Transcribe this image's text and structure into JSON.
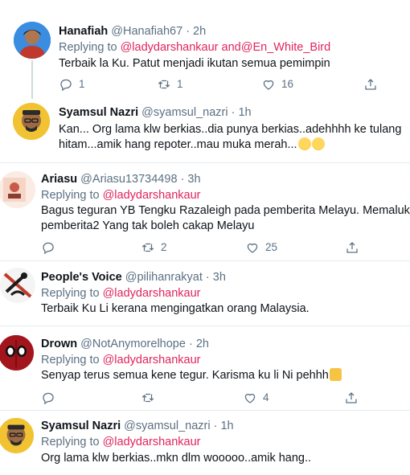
{
  "replying_label": "Replying to",
  "and_word": "and",
  "tweets": [
    {
      "name": "Hanafiah",
      "handle": "@Hanafiah67",
      "time": "· 2h",
      "mentions": [
        "@ladydarshankaur",
        "@En_White_Bird"
      ],
      "lines": [
        "Terbaik la Ku.  Patut menjadi ikutan semua pemimpin"
      ],
      "reply_count": "1",
      "retweet_count": "1",
      "like_count": "16"
    },
    {
      "name": "Syamsul Nazri",
      "handle": "@syamsul_nazri",
      "time": "· 1h",
      "lines": [
        "Kan... Org lama klw berkias..dia punya berkias..adehhhh ke tulang",
        "hitam...amik hang repoter..mau muka merah..."
      ],
      "emoji": [
        "grinning-sweat-emoji",
        "grinning-sweat-emoji"
      ]
    },
    {
      "name": "Ariasu",
      "handle": "@Ariasu13734498",
      "time": "· 3h",
      "mentions": [
        "@ladydarshankaur"
      ],
      "lines": [
        "Bagus teguran YB Tengku Razaleigh pada pemberita Melayu. Memalukan",
        "pemberita2 Yang tak boleh cakap Melayu"
      ],
      "retweet_count": "2",
      "like_count": "25"
    },
    {
      "name": "People's Voice",
      "handle": "@pilihanrakyat",
      "time": "· 3h",
      "mentions": [
        "@ladydarshankaur"
      ],
      "lines": [
        "Terbaik Ku Li kerana mengingatkan orang Malaysia."
      ]
    },
    {
      "name": "Drown",
      "handle": "@NotAnymorelhope",
      "time": "· 2h",
      "mentions": [
        "@ladydarshankaur"
      ],
      "lines": [
        "Senyap terus semua kene tegur. Karisma ku li Ni pehhh"
      ],
      "emoji": [
        "thumbs-up-emoji"
      ],
      "like_count": "4"
    },
    {
      "name": "Syamsul Nazri",
      "handle": "@syamsul_nazri",
      "time": "· 1h",
      "mentions": [
        "@ladydarshankaur"
      ],
      "lines": [
        "Org lama klw berkias..mkn dlm wooooo..amik hang.."
      ]
    }
  ],
  "colors": {
    "mention": "#e0245e",
    "secondary_text": "#5b7083",
    "divider": "#e6ecf0"
  },
  "icons": [
    "reply-icon",
    "retweet-icon",
    "like-icon",
    "share-icon"
  ]
}
